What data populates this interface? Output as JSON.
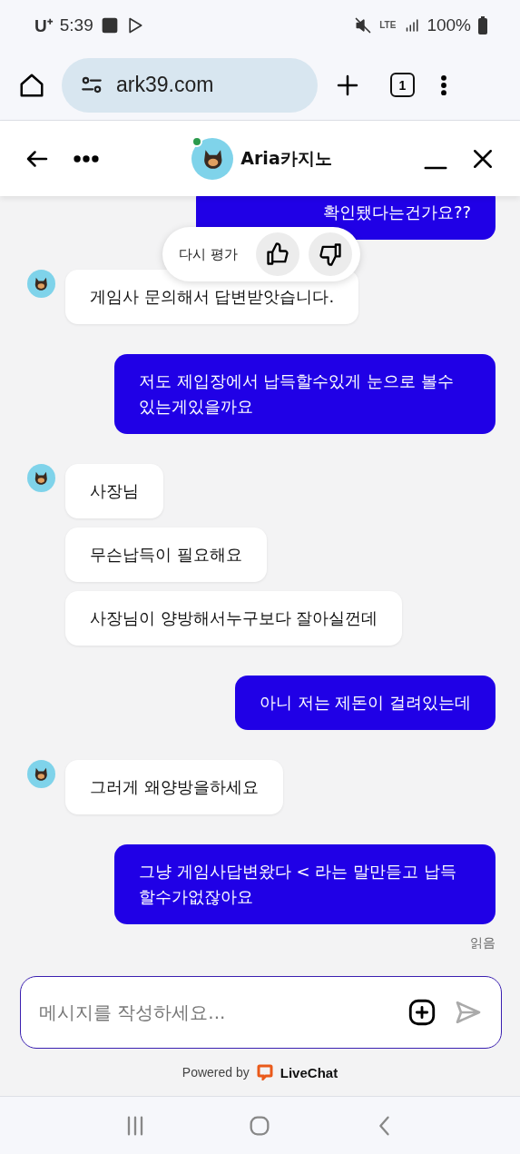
{
  "status_bar": {
    "carrier": "U⁺",
    "time": "5:39",
    "network": "LTE",
    "battery": "100%"
  },
  "browser": {
    "url": "ark39.com",
    "tab_count": "1"
  },
  "chat_header": {
    "title": "Aria카지노",
    "online": true
  },
  "rating_popup": {
    "label": "다시 평가"
  },
  "groups": [
    {
      "kind": "user",
      "messages": [
        "확인됐다는건가요??"
      ]
    },
    {
      "kind": "agent",
      "messages": [
        "게임사 문의해서 답변받앗습니다."
      ]
    },
    {
      "kind": "user",
      "messages": [
        "저도 제입장에서 납득할수있게 눈으로 볼수 있는게있을까요"
      ]
    },
    {
      "kind": "agent",
      "messages": [
        "사장님",
        "무슨납득이 필요해요",
        "사장님이 양방해서누구보다 잘아실껀데"
      ]
    },
    {
      "kind": "user",
      "messages": [
        "아니 저는 제돈이 걸려있는데"
      ]
    },
    {
      "kind": "agent",
      "messages": [
        "그러게 왜양방을하세요"
      ]
    },
    {
      "kind": "user",
      "messages": [
        "그냥 게임사답변왔다 < 라는 말만듣고 납득할수가없잖아요"
      ]
    }
  ],
  "read_receipt": "읽음",
  "composer": {
    "placeholder": "메시지를 작성하세요..."
  },
  "footer": {
    "powered_by": "Powered by",
    "brand": "LiveChat"
  }
}
